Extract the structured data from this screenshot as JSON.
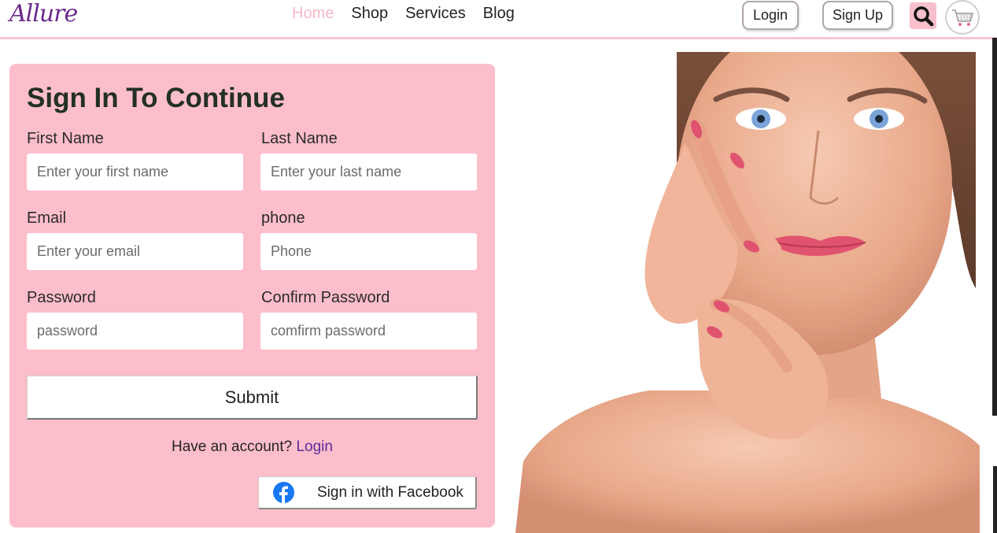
{
  "header": {
    "logo": "Allure",
    "nav": [
      {
        "label": "Home",
        "active": true
      },
      {
        "label": "Shop",
        "active": false
      },
      {
        "label": "Services",
        "active": false
      },
      {
        "label": "Blog",
        "active": false
      }
    ],
    "login_label": "Login",
    "signup_label": "Sign Up",
    "search_icon": "search-icon",
    "cart_icon": "cart-icon"
  },
  "form": {
    "title": "Sign In To Continue",
    "first_name": {
      "label": "First Name",
      "placeholder": "Enter your first name",
      "value": ""
    },
    "last_name": {
      "label": "Last Name",
      "placeholder": "Enter your last name",
      "value": ""
    },
    "email": {
      "label": "Email",
      "placeholder": "Enter your email",
      "value": ""
    },
    "phone": {
      "label": "phone",
      "placeholder": "Phone",
      "value": ""
    },
    "password": {
      "label": "Password",
      "placeholder": "password",
      "value": ""
    },
    "confirm_password": {
      "label": "Confirm Password",
      "placeholder": "comfirm password",
      "value": ""
    },
    "submit_label": "Submit",
    "have_account_text": "Have an account?",
    "have_account_link": "Login",
    "facebook_label": "Sign in with Facebook"
  },
  "colors": {
    "brand": "#6a2a8c",
    "card_bg": "#fdbecb",
    "active_nav": "#f5b8c6",
    "link": "#5a2a9c",
    "facebook": "#1877f2"
  },
  "image": {
    "subject": "woman-portrait"
  }
}
